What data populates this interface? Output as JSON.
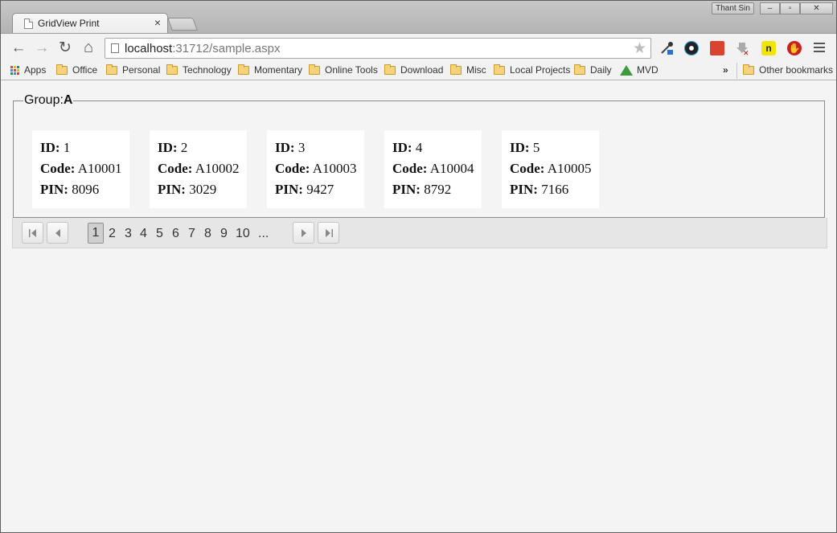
{
  "window": {
    "tab_title": "GridView Print",
    "tab_close": "×",
    "user_name": "Thant Sin",
    "controls": [
      "‒",
      "▫",
      "✕"
    ]
  },
  "toolbar": {
    "back_icon": "←",
    "forward_icon": "→",
    "reload_icon": "↻",
    "home_icon": "⌂",
    "url_host": "localhost",
    "url_path": ":31712/sample.aspx",
    "star_icon": "★"
  },
  "bookmarks": {
    "apps": "Apps",
    "items": [
      "Office",
      "Personal",
      "Technology",
      "Momentary",
      "Online Tools",
      "Download",
      "Misc",
      "Local Projects",
      "Daily",
      "MVD"
    ],
    "overflow": "»",
    "other": "Other bookmarks"
  },
  "group": {
    "label": "Group:",
    "value": "A"
  },
  "field_labels": {
    "id": "ID:",
    "code": "Code:",
    "pin": "PIN:"
  },
  "cards": [
    {
      "id": "1",
      "code": "A10001",
      "pin": "8096"
    },
    {
      "id": "2",
      "code": "A10002",
      "pin": "3029"
    },
    {
      "id": "3",
      "code": "A10003",
      "pin": "9427"
    },
    {
      "id": "4",
      "code": "A10004",
      "pin": "8792"
    },
    {
      "id": "5",
      "code": "A10005",
      "pin": "7166"
    }
  ],
  "pager": {
    "current": "1",
    "pages": [
      "2",
      "3",
      "4",
      "5",
      "6",
      "7",
      "8",
      "9",
      "10",
      "..."
    ]
  }
}
